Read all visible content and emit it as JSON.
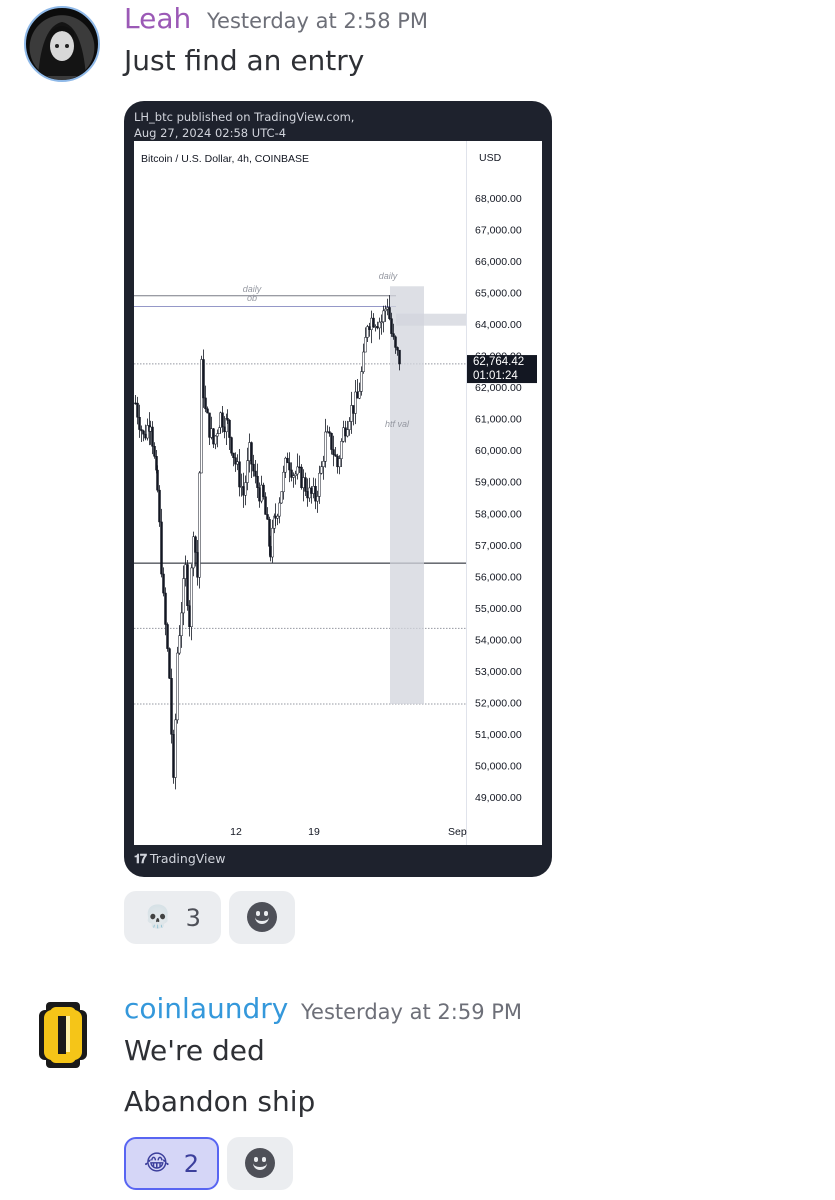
{
  "messages": [
    {
      "username": "Leah",
      "username_color": "#9b59b6",
      "timestamp": "Yesterday at 2:58 PM",
      "lines": [
        "Just find an entry"
      ],
      "reactions": [
        {
          "emoji": "💀",
          "count": "3",
          "active": false
        }
      ]
    },
    {
      "username": "coinlaundry",
      "username_color": "#3498db",
      "timestamp": "Yesterday at 2:59 PM",
      "lines": [
        "We're ded",
        "Abandon ship"
      ],
      "reactions": [
        {
          "emoji": "😂",
          "count": "2",
          "active": true
        }
      ]
    }
  ],
  "chart_card": {
    "published_line1": "LH_btc published on TradingView.com,",
    "published_line2": "Aug 27, 2024 02:58 UTC-4",
    "symbol": "Bitcoin / U.S. Dollar, 4h, COINBASE",
    "currency": "USD",
    "footer": "TradingView",
    "annotation_daily_ob_1": "daily",
    "annotation_daily_ob_2": "ob",
    "annotation_daily": "daily",
    "annotation_htf_val": "htf val",
    "price_tag": "62,764.42",
    "countdown": "01:01:24"
  },
  "chart_data": {
    "type": "candlestick",
    "title": "Bitcoin / U.S. Dollar, 4h, COINBASE",
    "y_ticks": [
      "68,000.00",
      "67,000.00",
      "66,000.00",
      "65,000.00",
      "64,000.00",
      "63,000.00",
      "62,000.00",
      "61,000.00",
      "60,000.00",
      "59,000.00",
      "58,000.00",
      "57,000.00",
      "56,000.00",
      "55,000.00",
      "54,000.00",
      "53,000.00",
      "52,000.00",
      "51,000.00",
      "50,000.00",
      "49,000.00"
    ],
    "x_ticks": [
      "12",
      "19",
      "Sep"
    ],
    "ylim": [
      48500,
      69000
    ],
    "current_price": 62764.42,
    "levels": [
      {
        "label": "daily ob",
        "value": 64900
      },
      {
        "label": "",
        "value": 64560
      },
      {
        "label": "",
        "value": 62740
      },
      {
        "label": "",
        "value": 56420
      },
      {
        "label": "",
        "value": 54350
      },
      {
        "label": "",
        "value": 51950
      }
    ],
    "path": [
      [
        0,
        61500
      ],
      [
        8,
        60400
      ],
      [
        15,
        61000
      ],
      [
        22,
        58700
      ],
      [
        28,
        55200
      ],
      [
        34,
        52800
      ],
      [
        38,
        49300
      ],
      [
        42,
        53600
      ],
      [
        46,
        55000
      ],
      [
        50,
        56200
      ],
      [
        54,
        54600
      ],
      [
        58,
        57600
      ],
      [
        62,
        56000
      ],
      [
        66,
        62600
      ],
      [
        70,
        61200
      ],
      [
        78,
        60200
      ],
      [
        85,
        61100
      ],
      [
        92,
        60800
      ],
      [
        100,
        59600
      ],
      [
        108,
        58600
      ],
      [
        114,
        59900
      ],
      [
        120,
        59000
      ],
      [
        128,
        58400
      ],
      [
        135,
        56800
      ],
      [
        140,
        57900
      ],
      [
        146,
        58800
      ],
      [
        152,
        59800
      ],
      [
        158,
        59300
      ],
      [
        166,
        59100
      ],
      [
        174,
        58600
      ],
      [
        180,
        58500
      ],
      [
        186,
        59400
      ],
      [
        190,
        60400
      ],
      [
        196,
        60200
      ],
      [
        202,
        59500
      ],
      [
        208,
        60600
      ],
      [
        214,
        61200
      ],
      [
        222,
        61600
      ],
      [
        228,
        62800
      ],
      [
        232,
        64100
      ],
      [
        238,
        64200
      ],
      [
        246,
        64100
      ],
      [
        252,
        64700
      ],
      [
        256,
        63700
      ],
      [
        260,
        63100
      ],
      [
        266,
        62780
      ]
    ]
  }
}
